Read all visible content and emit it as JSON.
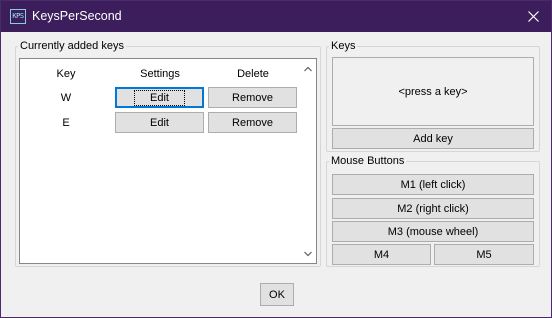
{
  "window": {
    "title": "KeysPerSecond",
    "icon_text": "KPS"
  },
  "keys_list": {
    "group_label": "Currently added keys",
    "columns": [
      "Key",
      "Settings",
      "Delete"
    ],
    "rows": [
      {
        "key": "W",
        "settings": "Edit",
        "delete": "Remove"
      },
      {
        "key": "E",
        "settings": "Edit",
        "delete": "Remove"
      }
    ]
  },
  "keys_panel": {
    "group_label": "Keys",
    "press_prompt": "<press a key>",
    "add_key_label": "Add key"
  },
  "mouse_panel": {
    "group_label": "Mouse Buttons",
    "m1": "M1 (left click)",
    "m2": "M2 (right click)",
    "m3": "M3 (mouse wheel)",
    "m4": "M4",
    "m5": "M5"
  },
  "ok_label": "OK",
  "colors": {
    "titlebar": "#3c1e5c",
    "focus_border": "#0078d7"
  },
  "icons": [
    "kps-app-icon",
    "close-icon",
    "scroll-up-icon",
    "scroll-down-icon"
  ]
}
